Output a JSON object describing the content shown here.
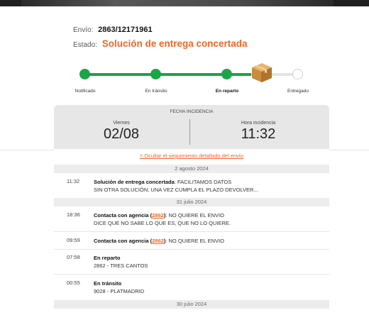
{
  "colors": {
    "accent": "#f26522",
    "progress": "#1aa546",
    "card_bg": "#e7e7e7"
  },
  "shipment": {
    "envio_label": "Envío:",
    "envio_value": "2863/12171961",
    "estado_label": "Estado:",
    "estado_value": "Solución de entrega concertada"
  },
  "progress": {
    "completed_fraction": 0.78,
    "steps": [
      {
        "label": "Notificado",
        "state": "done"
      },
      {
        "label": "En tránsito",
        "state": "done"
      },
      {
        "label": "En reparto",
        "state": "current"
      },
      {
        "label": "Entregado",
        "state": "pending"
      }
    ],
    "current_icon": "package-box-icon"
  },
  "incidence": {
    "title": "FECHA INCIDENCIA",
    "day_name": "Viernes",
    "date": "02/08",
    "hour_label": "Hora incidencia",
    "hour": "11:32"
  },
  "toggle_link": "˄ Ocultar el seguimiento detallado del envío",
  "days": [
    {
      "header": "2 agosto 2024"
    },
    {
      "header": "31 julio 2024"
    },
    {
      "header": "30 julio 2024"
    }
  ],
  "events": [
    {
      "time": "11:32",
      "title": "Solución de entrega concertada",
      "sep": ": ",
      "text1": "FACILITAMOS DATOS",
      "text2": "SIN OTRA SOLUCIÓN, UNA VEZ CUMPLA EL PLAZO DEVOLVER..."
    },
    {
      "time": "18:36",
      "title": "Contacta con agencia",
      "code": "2862",
      "text1": ": NO QUIERE EL ENVIO",
      "text2": "DICE QUE NO SABE LO QUE ES, QUE NO LO QUIERE."
    },
    {
      "time": "09:59",
      "title": "Contacta con agencia",
      "code": "2862",
      "text1": ": NO QUIERE EL ENVIO"
    },
    {
      "time": "07:58",
      "title": "En reparto",
      "text2": "2862 - TRES CANTOS"
    },
    {
      "time": "00:55",
      "title": "En tránsito",
      "text2": "9028 - PLATMADRID"
    }
  ]
}
